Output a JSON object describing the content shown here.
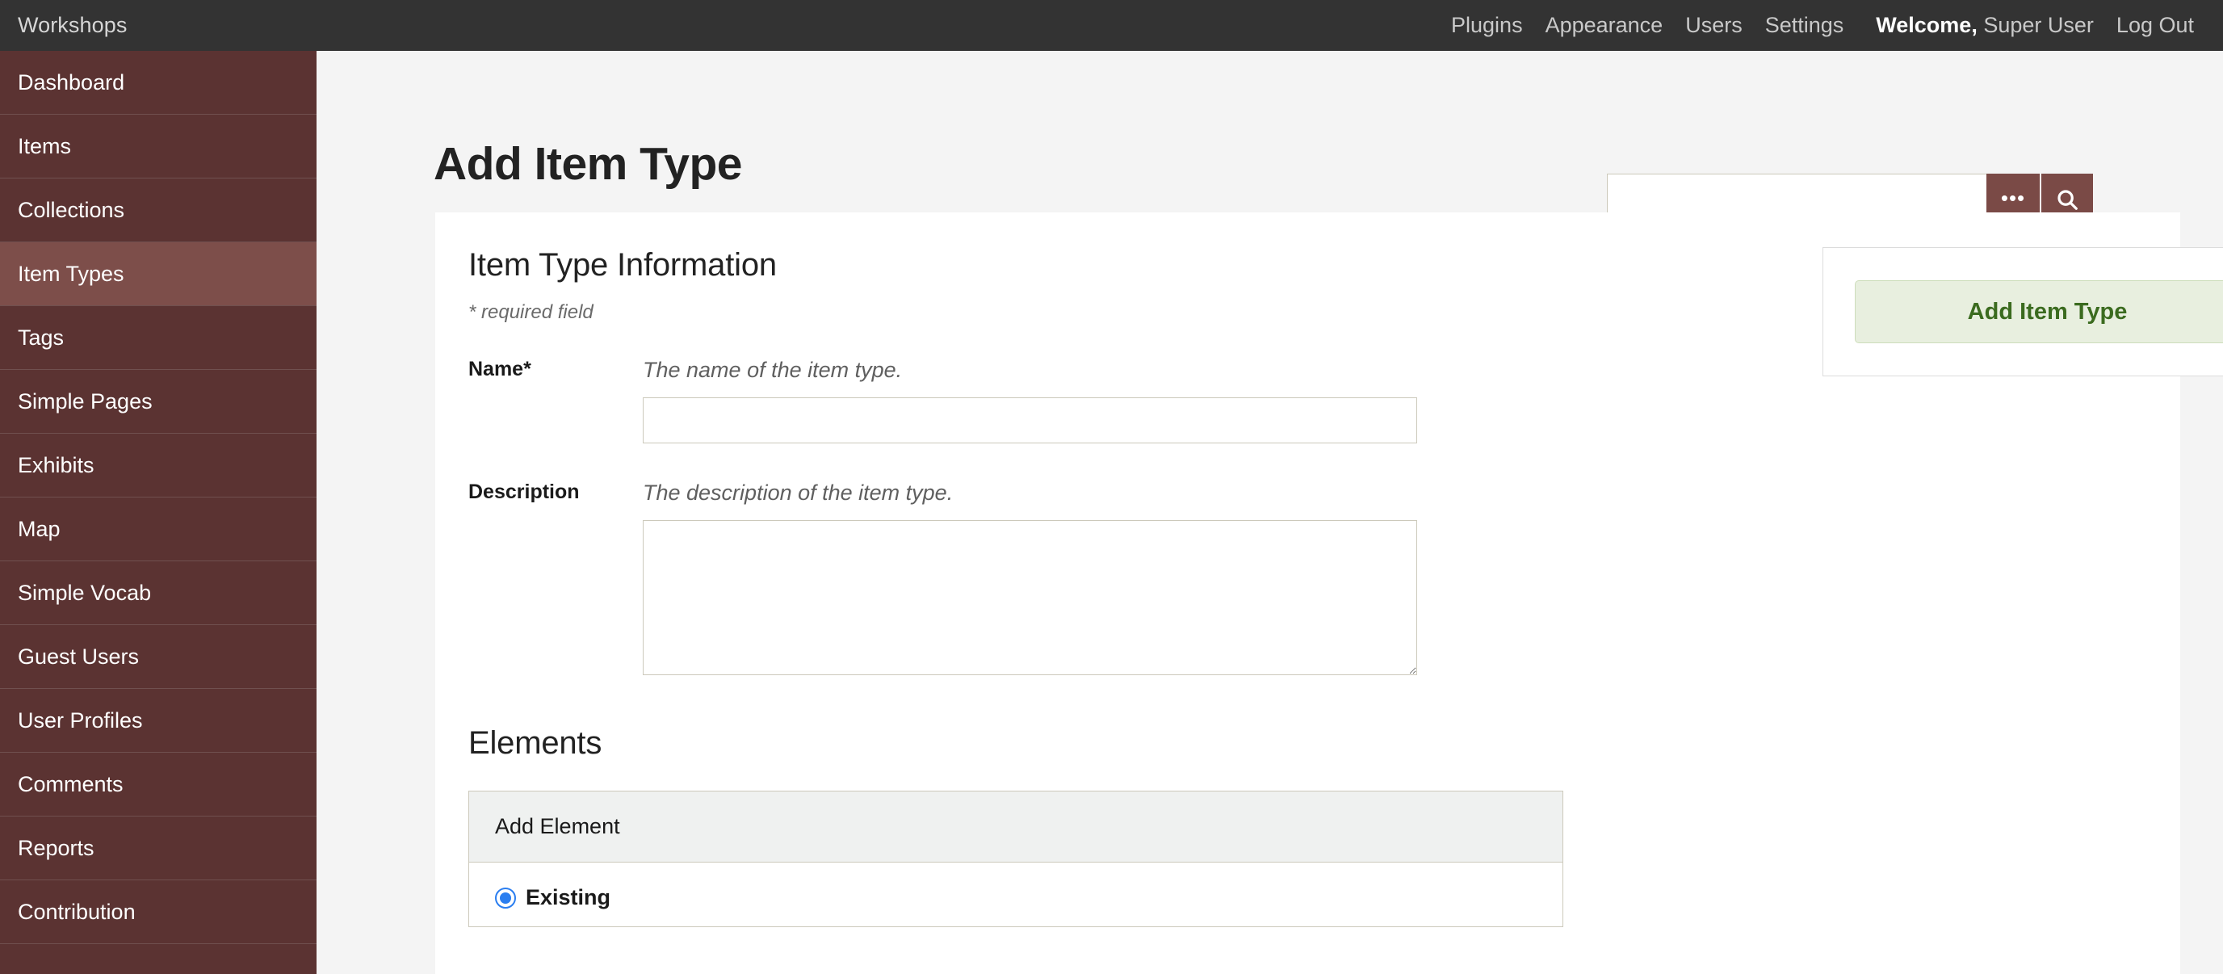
{
  "topbar": {
    "brand": "Workshops",
    "nav": [
      {
        "label": "Plugins",
        "name": "nav-plugins"
      },
      {
        "label": "Appearance",
        "name": "nav-appearance"
      },
      {
        "label": "Users",
        "name": "nav-users"
      },
      {
        "label": "Settings",
        "name": "nav-settings"
      }
    ],
    "welcome_prefix": "Welcome,",
    "welcome_user": "Super User",
    "logout": "Log Out"
  },
  "sidebar": {
    "items": [
      {
        "label": "Dashboard",
        "active": false
      },
      {
        "label": "Items",
        "active": false
      },
      {
        "label": "Collections",
        "active": false
      },
      {
        "label": "Item Types",
        "active": true
      },
      {
        "label": "Tags",
        "active": false
      },
      {
        "label": "Simple Pages",
        "active": false
      },
      {
        "label": "Exhibits",
        "active": false
      },
      {
        "label": "Map",
        "active": false
      },
      {
        "label": "Simple Vocab",
        "active": false
      },
      {
        "label": "Guest Users",
        "active": false
      },
      {
        "label": "User Profiles",
        "active": false
      },
      {
        "label": "Comments",
        "active": false
      },
      {
        "label": "Reports",
        "active": false
      },
      {
        "label": "Contribution",
        "active": false
      }
    ]
  },
  "page": {
    "title": "Add Item Type"
  },
  "search": {
    "value": "",
    "placeholder": "",
    "advanced_icon": "ellipsis-icon",
    "submit_icon": "search-icon"
  },
  "form": {
    "section_title": "Item Type Information",
    "required_note": "* required field",
    "name_field": {
      "label": "Name*",
      "hint": "The name of the item type.",
      "value": "",
      "placeholder": ""
    },
    "description_field": {
      "label": "Description",
      "hint": "The description of the item type.",
      "value": "",
      "placeholder": ""
    }
  },
  "elements": {
    "title": "Elements",
    "box_header": "Add Element",
    "radio_existing": "Existing"
  },
  "actions": {
    "add_item_type": "Add Item Type"
  },
  "colors": {
    "topbar_bg": "#333333",
    "sidebar_bg": "#5b3332",
    "sidebar_active_bg": "#7d4e4a",
    "accent_brown": "#7a4a46",
    "page_bg": "#f4f4f4",
    "panel_bg": "#ffffff",
    "button_green_bg": "#e8efdf",
    "button_green_text": "#3b6b1f",
    "radio_blue": "#2b7ef0"
  }
}
